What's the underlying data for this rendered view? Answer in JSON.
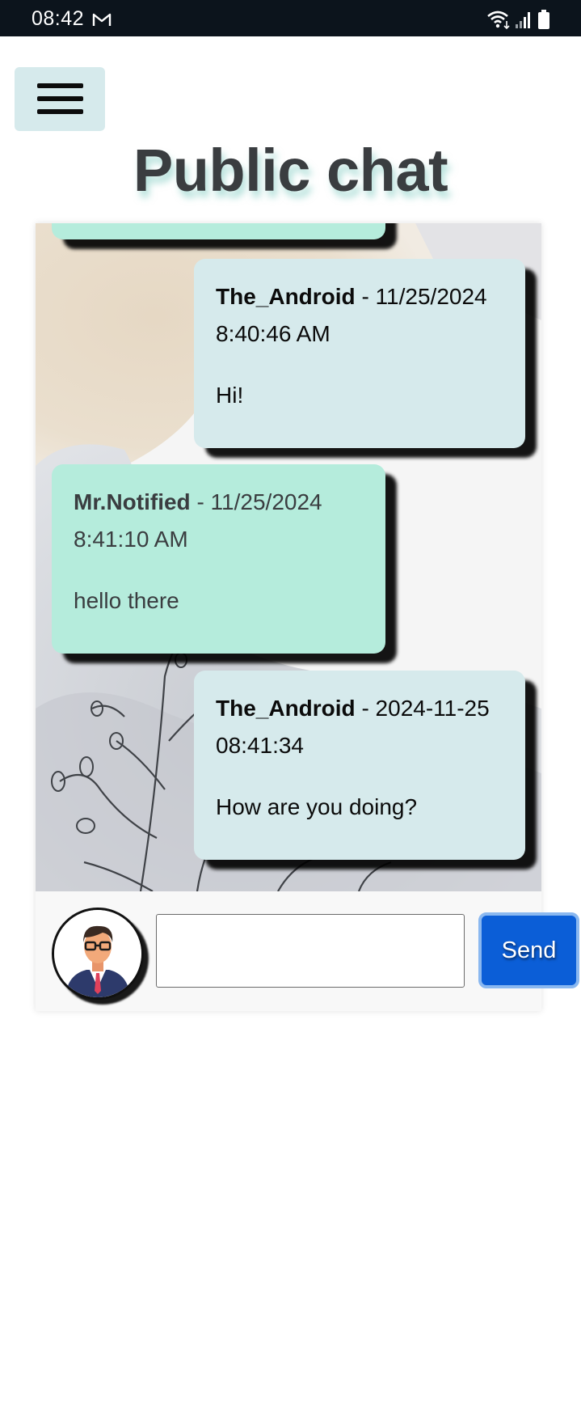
{
  "status_bar": {
    "time": "08:42",
    "icons": [
      "gmail-icon",
      "wifi-icon",
      "signal-icon",
      "battery-icon"
    ]
  },
  "header": {
    "menu_icon": "hamburger-menu-icon",
    "title": "Public chat"
  },
  "messages": [
    {
      "author": "The_Android",
      "timestamp": " - 11/25/2024",
      "time": "8:40:46 AM",
      "text": "Hi!",
      "own": true
    },
    {
      "author": "Mr.Notified",
      "timestamp": " - 11/25/2024",
      "time": "8:41:10 AM",
      "text": "hello there",
      "own": false
    },
    {
      "author": "The_Android",
      "timestamp": " - 2024-11-25",
      "time": "08:41:34",
      "text": "How are you doing?",
      "own": true
    }
  ],
  "composer": {
    "avatar_icon": "user-avatar-icon",
    "input_value": "",
    "input_placeholder": "",
    "send_label": "Send"
  },
  "colors": {
    "own_bubble": "#d6eaec",
    "other_bubble": "#b5ecdc",
    "send_button": "#0b5ed7",
    "status_bar": "#0c141c"
  }
}
